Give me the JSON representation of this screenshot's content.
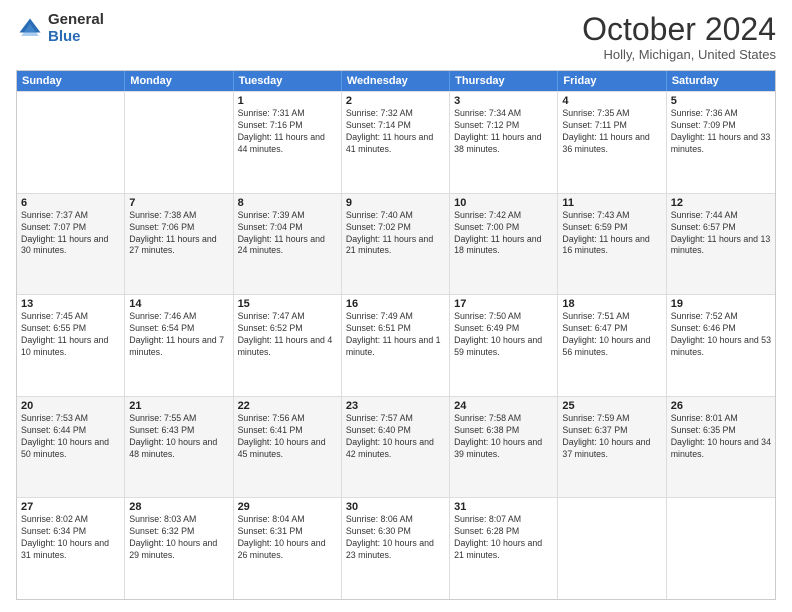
{
  "logo": {
    "general": "General",
    "blue": "Blue"
  },
  "title": "October 2024",
  "location": "Holly, Michigan, United States",
  "days_header": [
    "Sunday",
    "Monday",
    "Tuesday",
    "Wednesday",
    "Thursday",
    "Friday",
    "Saturday"
  ],
  "rows": [
    {
      "alt": false,
      "cells": [
        {
          "day": "",
          "content": ""
        },
        {
          "day": "",
          "content": ""
        },
        {
          "day": "1",
          "content": "Sunrise: 7:31 AM\nSunset: 7:16 PM\nDaylight: 11 hours and 44 minutes."
        },
        {
          "day": "2",
          "content": "Sunrise: 7:32 AM\nSunset: 7:14 PM\nDaylight: 11 hours and 41 minutes."
        },
        {
          "day": "3",
          "content": "Sunrise: 7:34 AM\nSunset: 7:12 PM\nDaylight: 11 hours and 38 minutes."
        },
        {
          "day": "4",
          "content": "Sunrise: 7:35 AM\nSunset: 7:11 PM\nDaylight: 11 hours and 36 minutes."
        },
        {
          "day": "5",
          "content": "Sunrise: 7:36 AM\nSunset: 7:09 PM\nDaylight: 11 hours and 33 minutes."
        }
      ]
    },
    {
      "alt": true,
      "cells": [
        {
          "day": "6",
          "content": "Sunrise: 7:37 AM\nSunset: 7:07 PM\nDaylight: 11 hours and 30 minutes."
        },
        {
          "day": "7",
          "content": "Sunrise: 7:38 AM\nSunset: 7:06 PM\nDaylight: 11 hours and 27 minutes."
        },
        {
          "day": "8",
          "content": "Sunrise: 7:39 AM\nSunset: 7:04 PM\nDaylight: 11 hours and 24 minutes."
        },
        {
          "day": "9",
          "content": "Sunrise: 7:40 AM\nSunset: 7:02 PM\nDaylight: 11 hours and 21 minutes."
        },
        {
          "day": "10",
          "content": "Sunrise: 7:42 AM\nSunset: 7:00 PM\nDaylight: 11 hours and 18 minutes."
        },
        {
          "day": "11",
          "content": "Sunrise: 7:43 AM\nSunset: 6:59 PM\nDaylight: 11 hours and 16 minutes."
        },
        {
          "day": "12",
          "content": "Sunrise: 7:44 AM\nSunset: 6:57 PM\nDaylight: 11 hours and 13 minutes."
        }
      ]
    },
    {
      "alt": false,
      "cells": [
        {
          "day": "13",
          "content": "Sunrise: 7:45 AM\nSunset: 6:55 PM\nDaylight: 11 hours and 10 minutes."
        },
        {
          "day": "14",
          "content": "Sunrise: 7:46 AM\nSunset: 6:54 PM\nDaylight: 11 hours and 7 minutes."
        },
        {
          "day": "15",
          "content": "Sunrise: 7:47 AM\nSunset: 6:52 PM\nDaylight: 11 hours and 4 minutes."
        },
        {
          "day": "16",
          "content": "Sunrise: 7:49 AM\nSunset: 6:51 PM\nDaylight: 11 hours and 1 minute."
        },
        {
          "day": "17",
          "content": "Sunrise: 7:50 AM\nSunset: 6:49 PM\nDaylight: 10 hours and 59 minutes."
        },
        {
          "day": "18",
          "content": "Sunrise: 7:51 AM\nSunset: 6:47 PM\nDaylight: 10 hours and 56 minutes."
        },
        {
          "day": "19",
          "content": "Sunrise: 7:52 AM\nSunset: 6:46 PM\nDaylight: 10 hours and 53 minutes."
        }
      ]
    },
    {
      "alt": true,
      "cells": [
        {
          "day": "20",
          "content": "Sunrise: 7:53 AM\nSunset: 6:44 PM\nDaylight: 10 hours and 50 minutes."
        },
        {
          "day": "21",
          "content": "Sunrise: 7:55 AM\nSunset: 6:43 PM\nDaylight: 10 hours and 48 minutes."
        },
        {
          "day": "22",
          "content": "Sunrise: 7:56 AM\nSunset: 6:41 PM\nDaylight: 10 hours and 45 minutes."
        },
        {
          "day": "23",
          "content": "Sunrise: 7:57 AM\nSunset: 6:40 PM\nDaylight: 10 hours and 42 minutes."
        },
        {
          "day": "24",
          "content": "Sunrise: 7:58 AM\nSunset: 6:38 PM\nDaylight: 10 hours and 39 minutes."
        },
        {
          "day": "25",
          "content": "Sunrise: 7:59 AM\nSunset: 6:37 PM\nDaylight: 10 hours and 37 minutes."
        },
        {
          "day": "26",
          "content": "Sunrise: 8:01 AM\nSunset: 6:35 PM\nDaylight: 10 hours and 34 minutes."
        }
      ]
    },
    {
      "alt": false,
      "cells": [
        {
          "day": "27",
          "content": "Sunrise: 8:02 AM\nSunset: 6:34 PM\nDaylight: 10 hours and 31 minutes."
        },
        {
          "day": "28",
          "content": "Sunrise: 8:03 AM\nSunset: 6:32 PM\nDaylight: 10 hours and 29 minutes."
        },
        {
          "day": "29",
          "content": "Sunrise: 8:04 AM\nSunset: 6:31 PM\nDaylight: 10 hours and 26 minutes."
        },
        {
          "day": "30",
          "content": "Sunrise: 8:06 AM\nSunset: 6:30 PM\nDaylight: 10 hours and 23 minutes."
        },
        {
          "day": "31",
          "content": "Sunrise: 8:07 AM\nSunset: 6:28 PM\nDaylight: 10 hours and 21 minutes."
        },
        {
          "day": "",
          "content": ""
        },
        {
          "day": "",
          "content": ""
        }
      ]
    }
  ]
}
